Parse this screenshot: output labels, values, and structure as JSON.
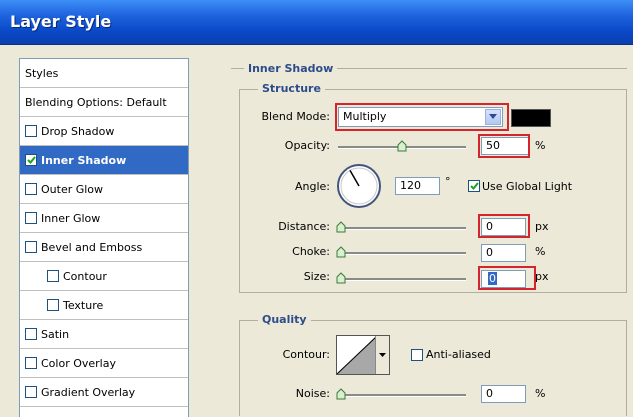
{
  "window": {
    "title": "Layer Style"
  },
  "styles_list": [
    {
      "label": "Styles",
      "checkbox": false,
      "checked": false,
      "selected": false,
      "indent": 0
    },
    {
      "label": "Blending Options: Default",
      "checkbox": false,
      "checked": false,
      "selected": false,
      "indent": 0
    },
    {
      "label": "Drop Shadow",
      "checkbox": true,
      "checked": false,
      "selected": false,
      "indent": 0
    },
    {
      "label": "Inner Shadow",
      "checkbox": true,
      "checked": true,
      "selected": true,
      "indent": 0
    },
    {
      "label": "Outer Glow",
      "checkbox": true,
      "checked": false,
      "selected": false,
      "indent": 0
    },
    {
      "label": "Inner Glow",
      "checkbox": true,
      "checked": false,
      "selected": false,
      "indent": 0
    },
    {
      "label": "Bevel and Emboss",
      "checkbox": true,
      "checked": false,
      "selected": false,
      "indent": 0
    },
    {
      "label": "Contour",
      "checkbox": true,
      "checked": false,
      "selected": false,
      "indent": 1
    },
    {
      "label": "Texture",
      "checkbox": true,
      "checked": false,
      "selected": false,
      "indent": 1
    },
    {
      "label": "Satin",
      "checkbox": true,
      "checked": false,
      "selected": false,
      "indent": 0
    },
    {
      "label": "Color Overlay",
      "checkbox": true,
      "checked": false,
      "selected": false,
      "indent": 0
    },
    {
      "label": "Gradient Overlay",
      "checkbox": true,
      "checked": false,
      "selected": false,
      "indent": 0
    }
  ],
  "inner_shadow": {
    "section_title": "Inner Shadow",
    "structure_title": "Structure",
    "blend_mode_label": "Blend Mode:",
    "blend_mode_value": "Multiply",
    "shadow_color": "#000000",
    "opacity_label": "Opacity:",
    "opacity_value": "50",
    "opacity_unit": "%",
    "opacity_slider_fraction": 0.5,
    "angle_label": "Angle:",
    "angle_value": "120",
    "angle_unit": "°",
    "angle_degrees": 120,
    "use_global_light_label": "Use Global Light",
    "use_global_light_checked": true,
    "distance_label": "Distance:",
    "distance_value": "0",
    "distance_unit": "px",
    "choke_label": "Choke:",
    "choke_value": "0",
    "choke_unit": "%",
    "size_label": "Size:",
    "size_value": "0",
    "size_unit": "px"
  },
  "quality": {
    "section_title": "Quality",
    "contour_label": "Contour:",
    "anti_aliased_label": "Anti-aliased",
    "anti_aliased_checked": false,
    "noise_label": "Noise:",
    "noise_value": "0",
    "noise_unit": "%"
  },
  "colors": {
    "highlight_box": "#d6242c",
    "selection": "#316ac5",
    "section_title": "#2d4c8c"
  }
}
